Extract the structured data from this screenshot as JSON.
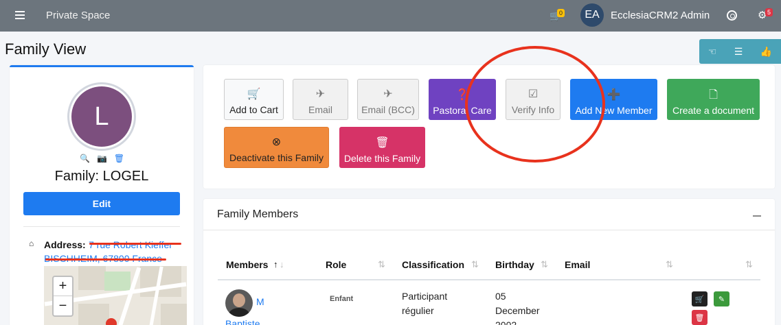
{
  "navbar": {
    "brand": "Private Space",
    "cart_count": "0",
    "avatar_initials": "EA",
    "user_name": "EcclesiaCRM2 Admin",
    "notifications_count": "5"
  },
  "page": {
    "title": "Family View"
  },
  "family": {
    "avatar_letter": "L",
    "name": "Family: LOGEL",
    "edit_label": "Edit",
    "address_label": "Address:",
    "address_line1": "7 rue Robert Kieffer",
    "address_line2": "BISCHHEIM, 67800 France"
  },
  "map": {
    "zoom_in": "+",
    "zoom_out": "−"
  },
  "actions": {
    "add_to_cart": "Add to Cart",
    "email": "Email",
    "email_bcc": "Email (BCC)",
    "pastoral_care": "Pastoral Care",
    "verify_info": "Verify Info",
    "add_new_member": "Add New Member",
    "create_document": "Create a document",
    "deactivate": "Deactivate this Family",
    "delete": "Delete this Family"
  },
  "members": {
    "title": "Family Members",
    "columns": [
      "Members",
      "Role",
      "Classification",
      "Birthday",
      "Email"
    ],
    "rows": [
      {
        "name_line1": "M",
        "name_line2": "Baptiste",
        "role": "Enfant",
        "classification_line1": "Participant",
        "classification_line2": "régulier",
        "birthday_line1": "05",
        "birthday_line2": "December",
        "birthday_line3": "2002"
      }
    ]
  },
  "colors": {
    "primary": "#1e7bf0",
    "navbar": "#6c757d",
    "purple": "#6f42c1",
    "green": "#3fa85a",
    "orange": "#f08a3c",
    "pink": "#d63367",
    "annotation": "#e8321d"
  }
}
